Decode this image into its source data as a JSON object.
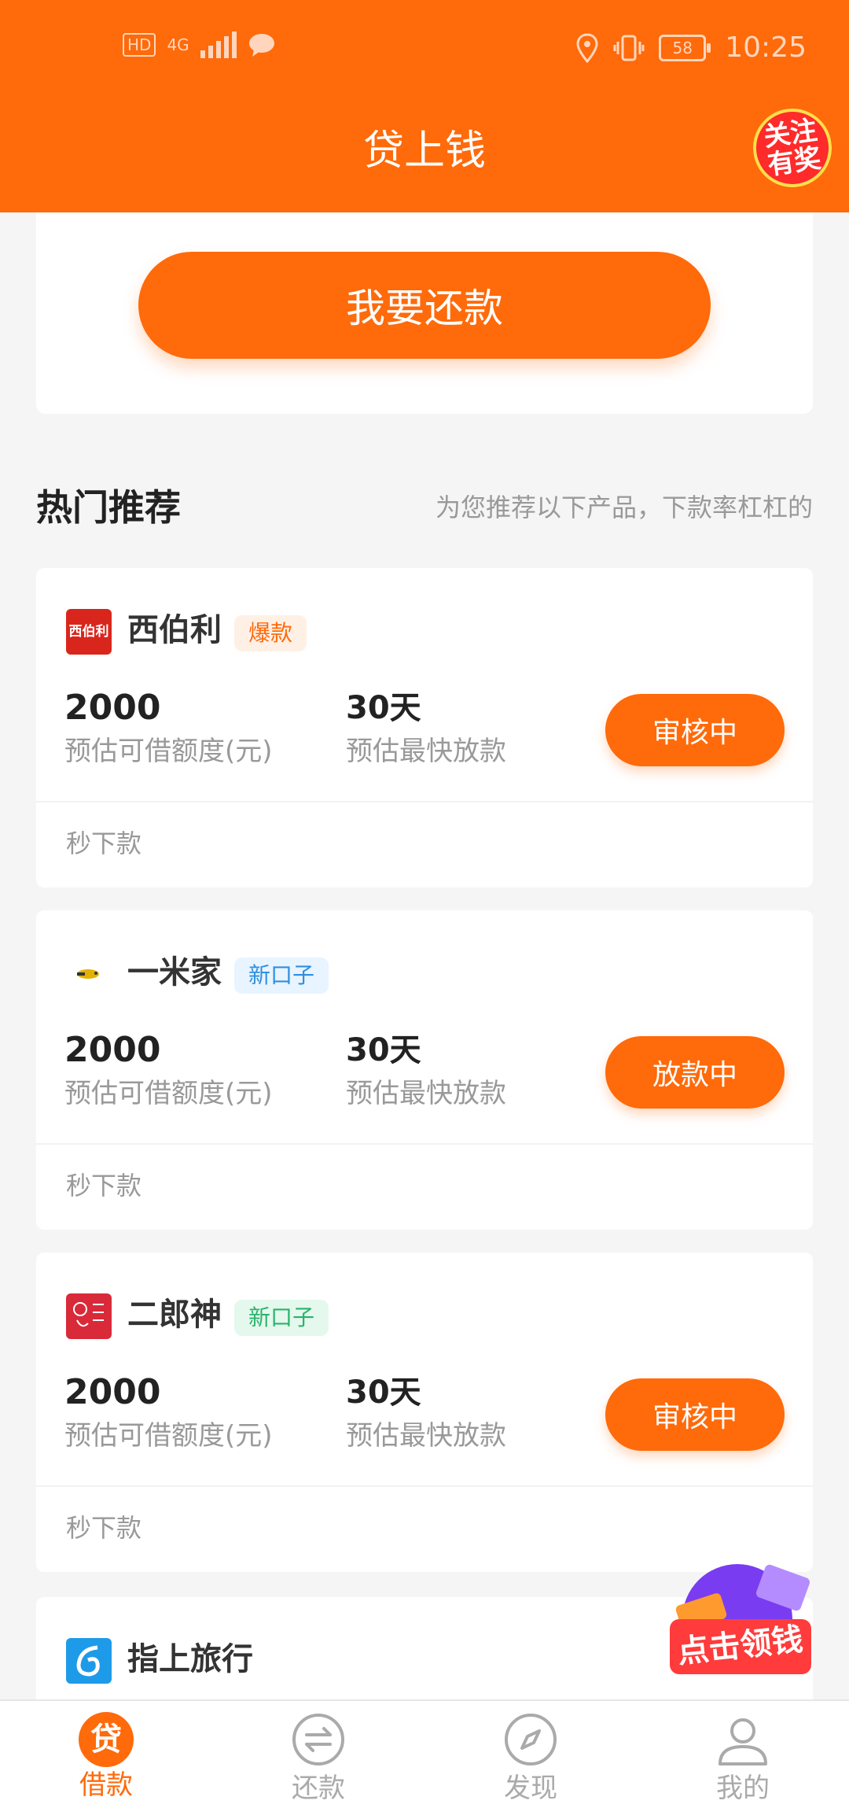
{
  "status_bar": {
    "time": "10:25",
    "battery": "58",
    "network": "4G",
    "hd": "HD"
  },
  "header": {
    "title": "贷上钱",
    "badge_line1": "关注",
    "badge_line2": "有奖"
  },
  "repay": {
    "button_label": "我要还款"
  },
  "section": {
    "title": "热门推荐",
    "subtitle": "为您推荐以下产品，下款率杠杠的"
  },
  "products": [
    {
      "name": "西伯利",
      "logo_text": "西伯利",
      "tag": "爆款",
      "amount": "2000",
      "amount_label": "预估可借额度(元)",
      "days": "30天",
      "days_label": "预估最快放款",
      "button": "审核中",
      "footer": "秒下款"
    },
    {
      "name": "一米家",
      "tag": "新口子",
      "amount": "2000",
      "amount_label": "预估可借额度(元)",
      "days": "30天",
      "days_label": "预估最快放款",
      "button": "放款中",
      "footer": "秒下款"
    },
    {
      "name": "二郎神",
      "tag": "新口子",
      "amount": "2000",
      "amount_label": "预估可借额度(元)",
      "days": "30天",
      "days_label": "预估最快放款",
      "button": "审核中",
      "footer": "秒下款"
    },
    {
      "name": "指上旅行"
    }
  ],
  "float_promo": {
    "label": "点击领钱"
  },
  "tabbar": {
    "items": [
      {
        "label": "借款",
        "icon": "loan-icon",
        "icon_text": "贷"
      },
      {
        "label": "还款",
        "icon": "repay-icon"
      },
      {
        "label": "发现",
        "icon": "compass-icon"
      },
      {
        "label": "我的",
        "icon": "user-icon"
      }
    ]
  },
  "colors": {
    "primary": "#ff6a0a",
    "tag_hot_bg": "#fff0e6",
    "tag_hot_fg": "#ff6a0a",
    "tag_new_blue_bg": "#e8f4ff",
    "tag_new_blue_fg": "#2f8fe0",
    "tag_new_green_bg": "#e4f8ee",
    "tag_new_green_fg": "#2bb36b"
  }
}
